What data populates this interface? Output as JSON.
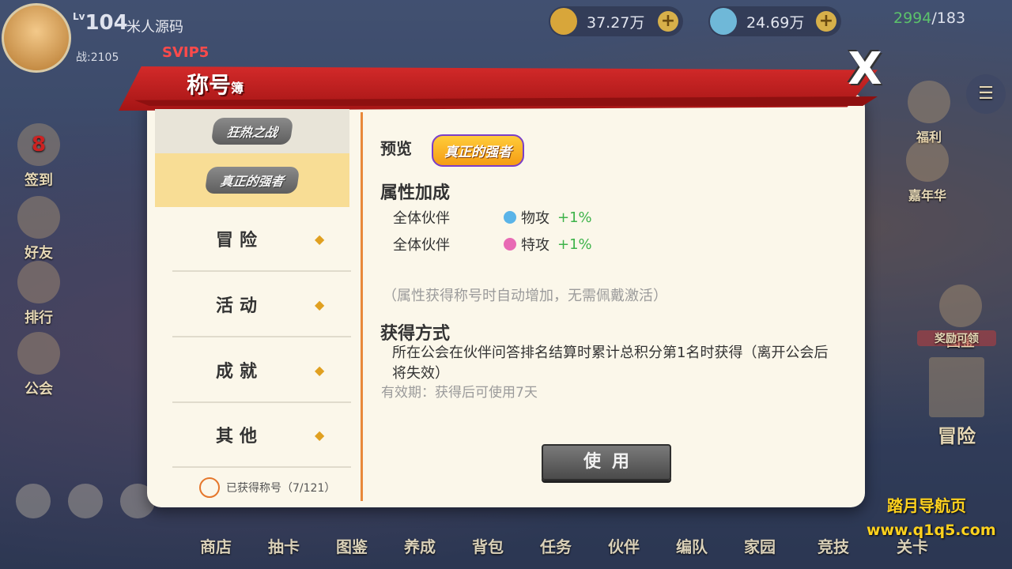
{
  "hud": {
    "level_prefix": "Lv",
    "level": "104",
    "player_name": "米人源码",
    "power": "战:2105",
    "vip": "SVIP5",
    "gold": "37.27万",
    "diamonds": "24.69万",
    "stamina_current": "2994",
    "stamina_max": "/183"
  },
  "side_left": {
    "checkin_day": "8",
    "checkin": "签到",
    "friends": "好友",
    "ranking": "排行",
    "guild": "公会"
  },
  "side_right": {
    "welfare": "福利",
    "carnival": "嘉年华",
    "atlas": "图鉴",
    "reward_claim": "奖励可领",
    "adventure": "冒险"
  },
  "bottom_nav": [
    "商店",
    "抽卡",
    "图鉴",
    "养成",
    "背包",
    "任务",
    "伙伴",
    "编队",
    "家园",
    "竞技",
    "关卡"
  ],
  "dialog": {
    "title_main": "称号",
    "title_sub": "簿",
    "close": "X",
    "list": {
      "titles": [
        "狂热之战",
        "真正的强者"
      ],
      "categories": [
        "冒险",
        "活动",
        "成就",
        "其他"
      ],
      "owned_label": "已获得称号（7/121）"
    },
    "detail": {
      "preview_label": "预览",
      "preview_title": "真正的强者",
      "attr_heading": "属性加成",
      "attributes": [
        {
          "target": "全体伙伴",
          "stat": "物攻",
          "bonus": "+1%",
          "gem_color": "#5ab4e8"
        },
        {
          "target": "全体伙伴",
          "stat": "特攻",
          "bonus": "+1%",
          "gem_color": "#e86ab4"
        }
      ],
      "note": "（属性获得称号时自动增加，无需佩戴激活）",
      "obtain_heading": "获得方式",
      "obtain_desc": "所在公会在伙伴问答排名结算时累计总积分第1名时获得（离开公会后将失效）",
      "validity": "有效期：获得后可使用7天",
      "use_button": "使用"
    }
  },
  "watermark": {
    "line1": "踏月导航页",
    "line2": "www.q1q5.com"
  }
}
